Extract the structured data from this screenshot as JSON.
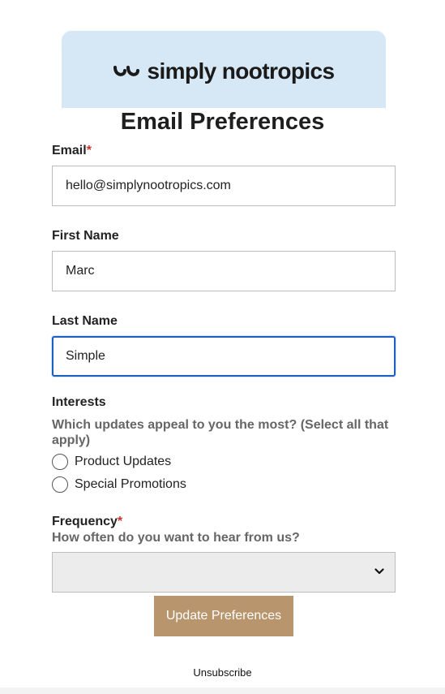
{
  "brand": {
    "logo_text": "simply nootropics",
    "banner_color": "#d6e7f5"
  },
  "page_title": "Email Preferences",
  "fields": {
    "email": {
      "label": "Email",
      "required_marker": "*",
      "value": "hello@simplynootropics.com"
    },
    "first_name": {
      "label": "First Name",
      "value": "Marc"
    },
    "last_name": {
      "label": "Last Name",
      "value": "Simple",
      "focused": true
    }
  },
  "interests": {
    "label": "Interests",
    "help": "Which updates appeal to you the most? (Select all that apply)",
    "options": [
      {
        "label": "Product Updates",
        "selected": false
      },
      {
        "label": "Special Promotions",
        "selected": false
      }
    ]
  },
  "frequency": {
    "label": "Frequency",
    "required_marker": "*",
    "help": "How often do you want to hear from us?",
    "selected_value": "",
    "icon": "chevron-down-icon"
  },
  "actions": {
    "submit_label": "Update Preferences",
    "submit_color": "#b8956c",
    "unsubscribe_label": "Unsubscribe"
  },
  "colors": {
    "required": "#d0312d",
    "focus_border": "#1d5fbf"
  }
}
